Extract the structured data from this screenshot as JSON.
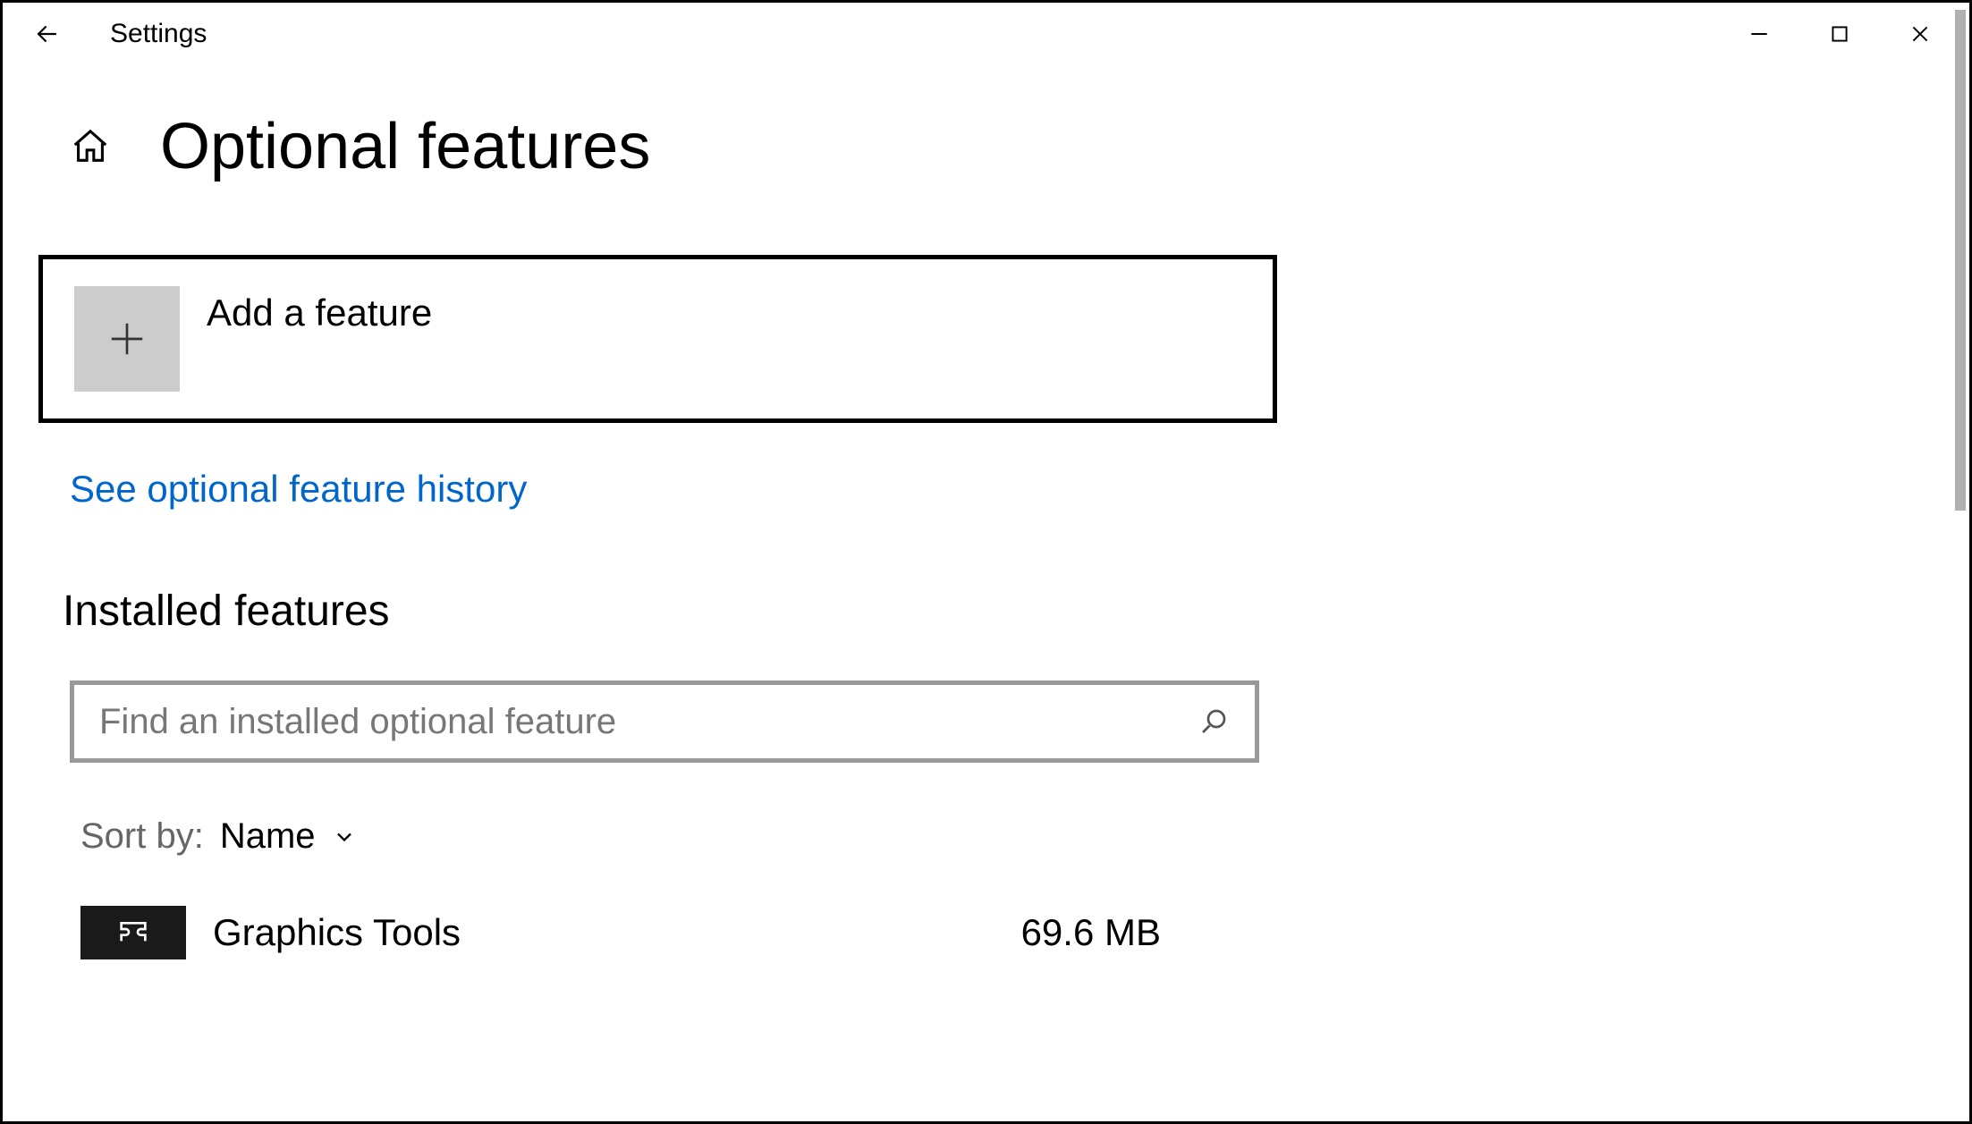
{
  "titlebar": {
    "app_name": "Settings"
  },
  "page": {
    "title": "Optional features"
  },
  "add_feature": {
    "label": "Add a feature"
  },
  "history_link": "See optional feature history",
  "installed": {
    "heading": "Installed features",
    "search_placeholder": "Find an installed optional feature",
    "sort_label": "Sort by:",
    "sort_value": "Name"
  },
  "features": [
    {
      "name": "Graphics Tools",
      "size": "69.6 MB"
    }
  ]
}
